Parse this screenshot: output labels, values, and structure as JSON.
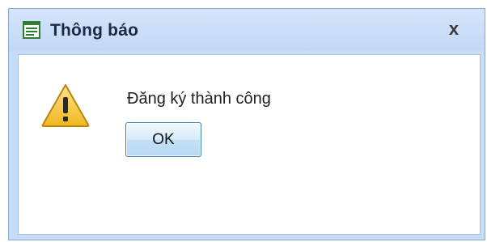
{
  "dialog": {
    "title": "Thông báo",
    "message": "Đăng ký thành công",
    "ok_label": "OK",
    "close_glyph": "x",
    "app_icon": "window-form-icon",
    "message_icon": "warning-triangle-icon"
  },
  "colors": {
    "titlebar": "#c7dcf7",
    "border": "#8aa6d6",
    "button_border": "#3c7fb1",
    "warning_yellow": "#f4c534"
  }
}
